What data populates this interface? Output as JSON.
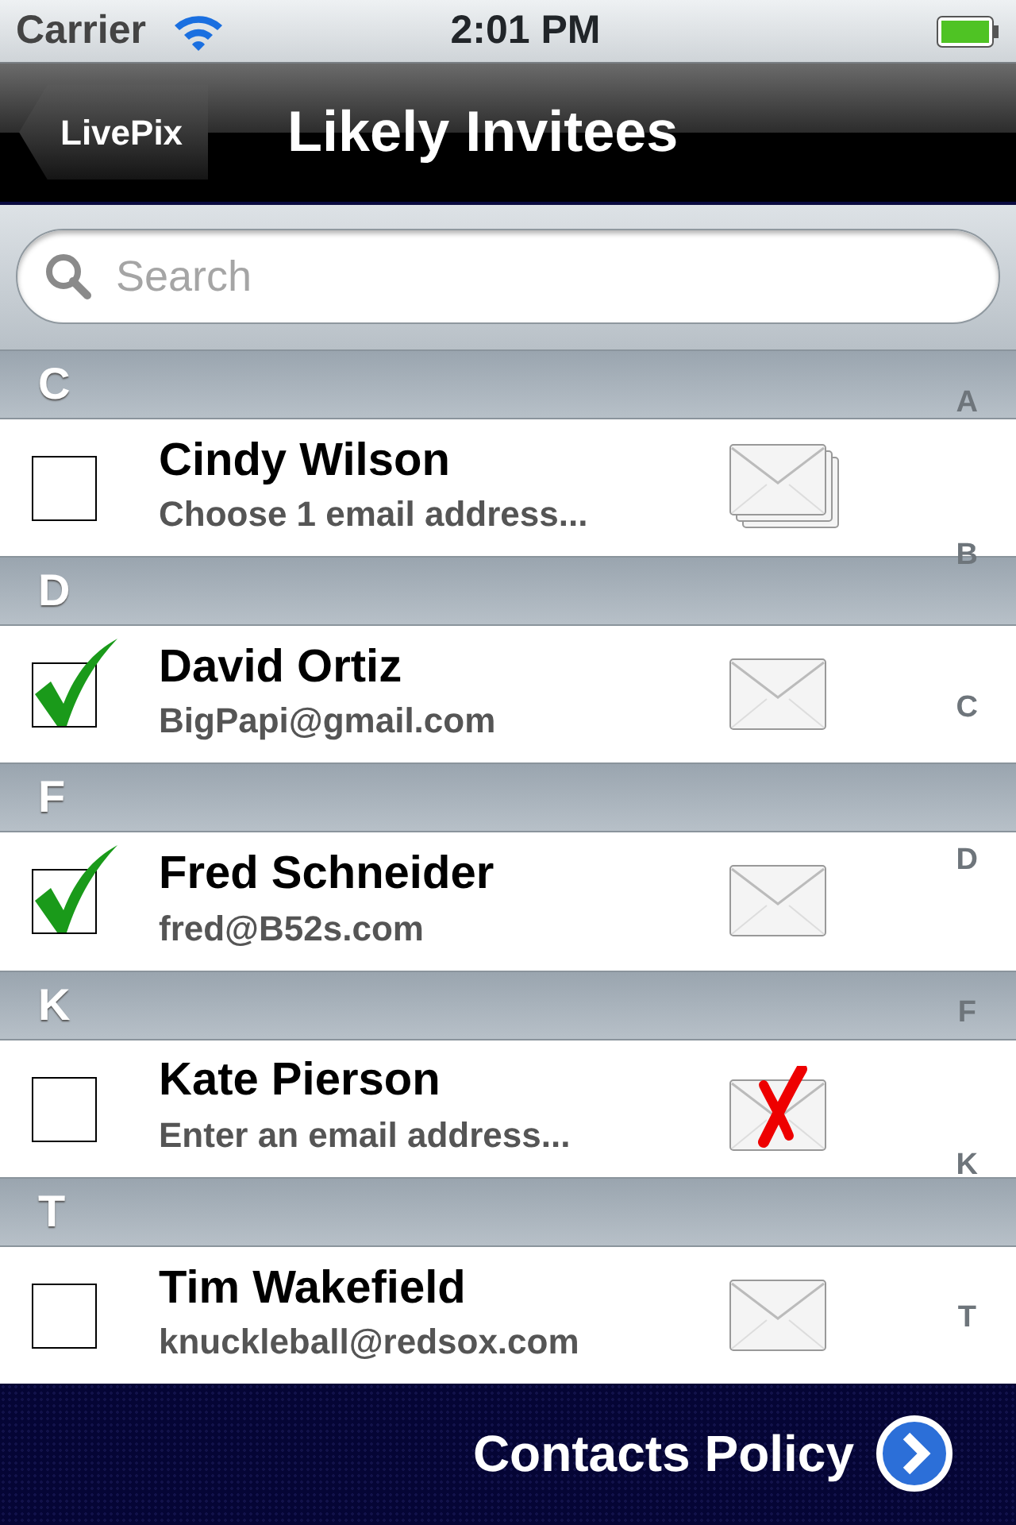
{
  "status_bar": {
    "carrier": "Carrier",
    "time": "2:01 PM"
  },
  "nav_bar": {
    "back": "LivePix",
    "title": "Likely Invitees"
  },
  "search": {
    "placeholder": "Search"
  },
  "sections": [
    {
      "letter": "C",
      "contacts": [
        {
          "name": "Cindy Wilson",
          "detail": "Choose 1 email address...",
          "checked": false,
          "kind": "multiple"
        }
      ]
    },
    {
      "letter": "D",
      "contacts": [
        {
          "name": "David Ortiz",
          "detail": "BigPapi@gmail.com",
          "checked": true,
          "kind": "single"
        }
      ]
    },
    {
      "letter": "F",
      "contacts": [
        {
          "name": "Fred Schneider",
          "detail": "fred@B52s.com",
          "checked": true,
          "kind": "single"
        }
      ]
    },
    {
      "letter": "K",
      "contacts": [
        {
          "name": "Kate Pierson",
          "detail": "Enter an email address...",
          "checked": false,
          "kind": "invalid"
        }
      ]
    },
    {
      "letter": "T",
      "contacts": [
        {
          "name": "Tim Wakefield",
          "detail": "knuckleball@redsox.com",
          "checked": false,
          "kind": "single"
        }
      ]
    }
  ],
  "index": [
    "A",
    "B",
    "C",
    "D",
    "F",
    "K",
    "T"
  ],
  "footer": {
    "link": "Contacts Policy"
  }
}
